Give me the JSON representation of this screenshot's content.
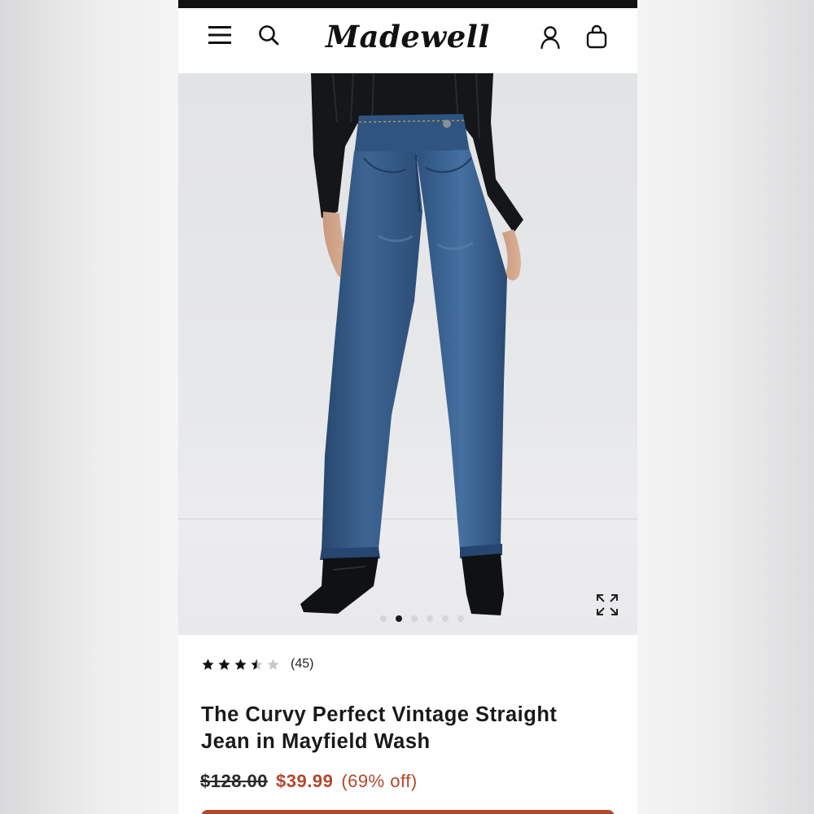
{
  "header": {
    "logo_text": "Madewell",
    "menu_icon": "hamburger-menu-icon",
    "search_icon": "search-icon",
    "account_icon": "account-icon",
    "bag_icon": "shopping-bag-icon"
  },
  "gallery": {
    "image_alt": "Model wearing high-rise straight leg jeans in a medium blue wash with black top and black ankle boots",
    "expand_icon": "expand-icon",
    "slide_count": 6,
    "active_slide": 2
  },
  "product": {
    "rating_value": 3.5,
    "rating_max": 5,
    "review_count": "(45)",
    "title_line1": "The Curvy Perfect Vintage Straight",
    "title_line2": "Jean in Mayfield Wash",
    "original_price": "$128.00",
    "sale_price": "$39.99",
    "discount": "(69% off)"
  },
  "colors": {
    "sale": "#b4462c",
    "text": "#1a1a1a",
    "denim": "#3a5f8a"
  }
}
